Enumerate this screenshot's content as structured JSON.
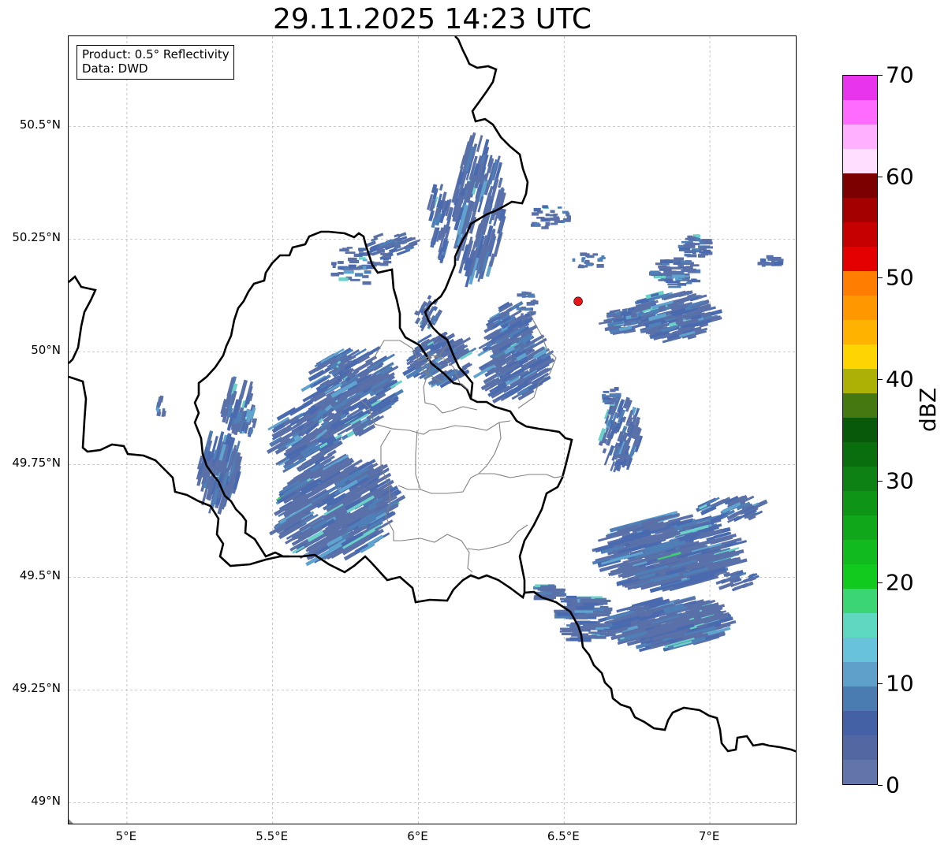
{
  "title": "29.11.2025 14:23 UTC",
  "info": {
    "product": "Product: 0.5° Reflectivity",
    "data_source": "Data: DWD"
  },
  "map": {
    "lon_range": [
      4.8,
      7.3
    ],
    "lat_range": [
      48.95,
      50.7
    ],
    "lat_ticks": [
      {
        "value": 49.0,
        "label": "49°N"
      },
      {
        "value": 49.25,
        "label": "49.25°N"
      },
      {
        "value": 49.5,
        "label": "49.5°N"
      },
      {
        "value": 49.75,
        "label": "49.75°N"
      },
      {
        "value": 50.0,
        "label": "50°N"
      },
      {
        "value": 50.25,
        "label": "50.25°N"
      },
      {
        "value": 50.5,
        "label": "50.5°N"
      }
    ],
    "lon_ticks": [
      {
        "value": 5.0,
        "label": "5°E"
      },
      {
        "value": 5.5,
        "label": "5.5°E"
      },
      {
        "value": 6.0,
        "label": "6°E"
      },
      {
        "value": 6.5,
        "label": "6.5°E"
      },
      {
        "value": 7.0,
        "label": "7°E"
      }
    ],
    "grid": true,
    "radar_site": {
      "lon": 6.548,
      "lat": 50.112,
      "color": "#e8161b"
    },
    "echo_colors": [
      "#5a70a8",
      "#4a6ab0",
      "#4f7fb7",
      "#5fa3cf",
      "#6ad0c8",
      "#3cd070"
    ]
  },
  "colorbar": {
    "label": "dBZ",
    "min": 0,
    "max": 70,
    "tick_labels": [
      {
        "value": 0,
        "label": "0"
      },
      {
        "value": 10,
        "label": "10"
      },
      {
        "value": 20,
        "label": "20"
      },
      {
        "value": 30,
        "label": "30"
      },
      {
        "value": 40,
        "label": "40"
      },
      {
        "value": 50,
        "label": "50"
      },
      {
        "value": 60,
        "label": "60"
      },
      {
        "value": 70,
        "label": "70"
      }
    ],
    "colors": [
      "#6275ab",
      "#5368a2",
      "#4461a6",
      "#4b7cb1",
      "#5ea0c9",
      "#68c2dc",
      "#5fd8c2",
      "#3bd673",
      "#12c91e",
      "#11bb1d",
      "#10a81a",
      "#0f9516",
      "#0d8113",
      "#0a6e0e",
      "#085a0a",
      "#457810",
      "#aeb105",
      "#ffd500",
      "#ffb300",
      "#ff9800",
      "#ff7d00",
      "#e50000",
      "#c60000",
      "#a40000",
      "#7d0000",
      "#ffdfff",
      "#ffb1ff",
      "#ff6aff",
      "#e934ee"
    ]
  }
}
